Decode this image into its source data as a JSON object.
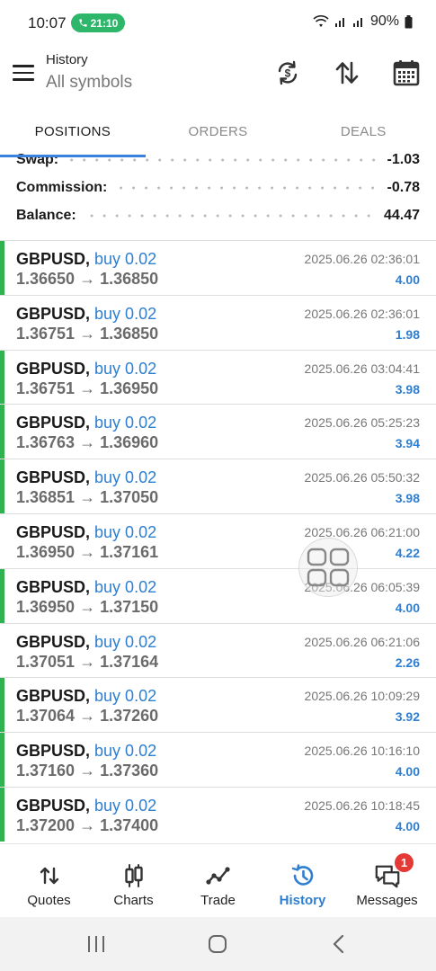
{
  "status_bar": {
    "time": "10:07",
    "call_timer": "21:10",
    "battery": "90%"
  },
  "header": {
    "title": "History",
    "subtitle": "All symbols"
  },
  "tabs": [
    {
      "label": "POSITIONS",
      "active": true
    },
    {
      "label": "ORDERS",
      "active": false
    },
    {
      "label": "DEALS",
      "active": false
    }
  ],
  "summary": [
    {
      "label": "Swap:",
      "value": "-1.03"
    },
    {
      "label": "Commission:",
      "value": "-0.78"
    },
    {
      "label": "Balance:",
      "value": "44.47"
    }
  ],
  "deals": [
    {
      "symbol": "GBPUSD,",
      "direction": "buy 0.02",
      "prices": "1.36650 → 1.36850",
      "time": "2025.06.26 02:36:01",
      "profit": "4.00",
      "marker": true
    },
    {
      "symbol": "GBPUSD,",
      "direction": "buy 0.02",
      "prices": "1.36751 → 1.36850",
      "time": "2025.06.26 02:36:01",
      "profit": "1.98",
      "marker": false
    },
    {
      "symbol": "GBPUSD,",
      "direction": "buy 0.02",
      "prices": "1.36751 → 1.36950",
      "time": "2025.06.26 03:04:41",
      "profit": "3.98",
      "marker": true
    },
    {
      "symbol": "GBPUSD,",
      "direction": "buy 0.02",
      "prices": "1.36763 → 1.36960",
      "time": "2025.06.26 05:25:23",
      "profit": "3.94",
      "marker": true
    },
    {
      "symbol": "GBPUSD,",
      "direction": "buy 0.02",
      "prices": "1.36851 → 1.37050",
      "time": "2025.06.26 05:50:32",
      "profit": "3.98",
      "marker": true
    },
    {
      "symbol": "GBPUSD,",
      "direction": "buy 0.02",
      "prices": "1.36950 → 1.37161",
      "time": "2025.06.26 06:21:00",
      "profit": "4.22",
      "marker": false
    },
    {
      "symbol": "GBPUSD,",
      "direction": "buy 0.02",
      "prices": "1.36950 → 1.37150",
      "time": "2025.06.26 06:05:39",
      "profit": "4.00",
      "marker": true
    },
    {
      "symbol": "GBPUSD,",
      "direction": "buy 0.02",
      "prices": "1.37051 → 1.37164",
      "time": "2025.06.26 06:21:06",
      "profit": "2.26",
      "marker": false
    },
    {
      "symbol": "GBPUSD,",
      "direction": "buy 0.02",
      "prices": "1.37064 → 1.37260",
      "time": "2025.06.26 10:09:29",
      "profit": "3.92",
      "marker": true
    },
    {
      "symbol": "GBPUSD,",
      "direction": "buy 0.02",
      "prices": "1.37160 → 1.37360",
      "time": "2025.06.26 10:16:10",
      "profit": "4.00",
      "marker": true
    },
    {
      "symbol": "GBPUSD,",
      "direction": "buy 0.02",
      "prices": "1.37200 → 1.37400",
      "time": "2025.06.26 10:18:45",
      "profit": "4.00",
      "marker": true
    }
  ],
  "bottom_nav": [
    {
      "label": "Quotes",
      "icon": "quotes-icon",
      "active": false
    },
    {
      "label": "Charts",
      "icon": "charts-icon",
      "active": false
    },
    {
      "label": "Trade",
      "icon": "trade-icon",
      "active": false
    },
    {
      "label": "History",
      "icon": "history-icon",
      "active": true
    },
    {
      "label": "Messages",
      "icon": "messages-icon",
      "active": false,
      "badge": "1"
    }
  ],
  "colors": {
    "accent": "#2e7fd1",
    "profit_marker": "#2fb24f",
    "badge": "#e53935",
    "call_pill": "#2eb66b"
  }
}
